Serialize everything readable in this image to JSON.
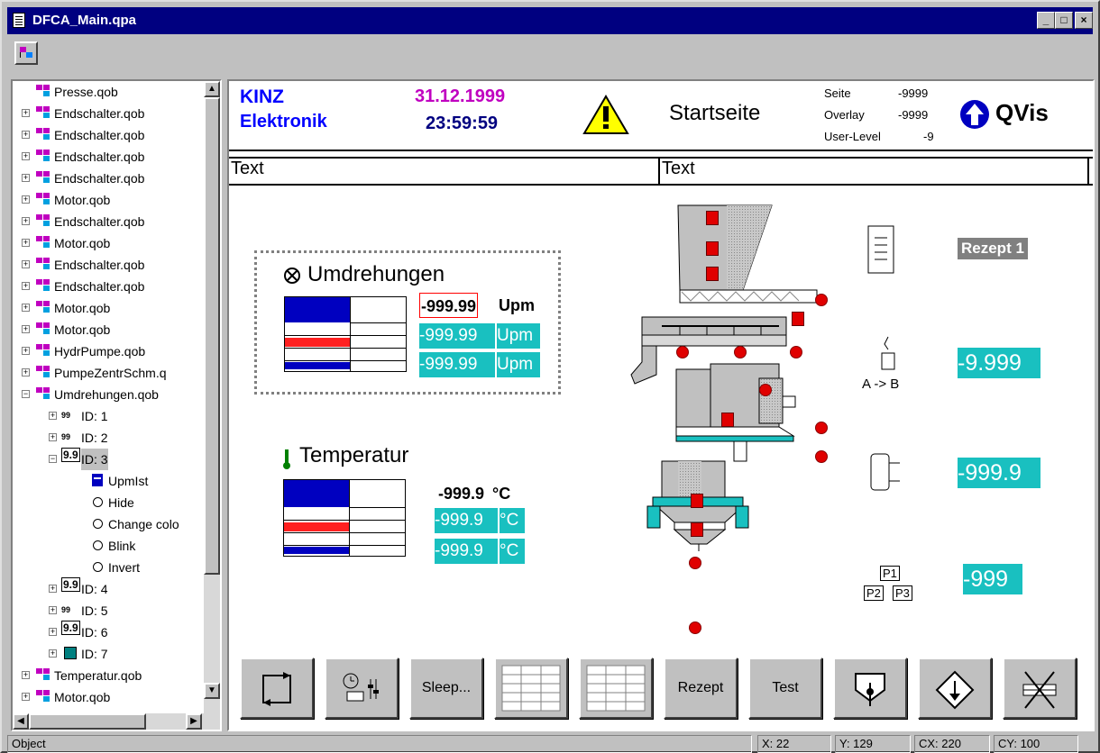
{
  "window": {
    "title": "DFCA_Main.qpa",
    "btn_min": "_",
    "btn_max": "□",
    "btn_close": "×"
  },
  "tree": {
    "items": [
      {
        "label": "Presse.qob",
        "icon": "component-icon"
      },
      {
        "label": "Endschalter.qob",
        "icon": "component-icon"
      },
      {
        "label": "Endschalter.qob",
        "icon": "component-icon"
      },
      {
        "label": "Endschalter.qob",
        "icon": "component-icon"
      },
      {
        "label": "Endschalter.qob",
        "icon": "component-icon"
      },
      {
        "label": "Motor.qob",
        "icon": "component-icon"
      },
      {
        "label": "Endschalter.qob",
        "icon": "component-icon"
      },
      {
        "label": "Motor.qob",
        "icon": "component-icon"
      },
      {
        "label": "Endschalter.qob",
        "icon": "component-icon"
      },
      {
        "label": "Endschalter.qob",
        "icon": "component-icon"
      },
      {
        "label": "Motor.qob",
        "icon": "component-icon"
      },
      {
        "label": "Motor.qob",
        "icon": "component-icon"
      },
      {
        "label": "HydrPumpe.qob",
        "icon": "component-icon"
      },
      {
        "label": "PumpeZentrSchm.q",
        "icon": "component-icon"
      },
      {
        "label": "Umdrehungen.qob",
        "icon": "component-icon"
      },
      {
        "label": "ID: 1",
        "icon": "bar-value-icon",
        "prefix": "99"
      },
      {
        "label": "ID: 2",
        "icon": "bar-value-icon",
        "prefix": "99"
      },
      {
        "label": "ID: 3",
        "icon": "value-icon",
        "prefix": "9.9"
      },
      {
        "label": "UpmIst",
        "icon": "list-icon"
      },
      {
        "label": "Hide",
        "icon": "radio-icon"
      },
      {
        "label": "Change colo",
        "icon": "radio-icon"
      },
      {
        "label": "Blink",
        "icon": "radio-icon"
      },
      {
        "label": "Invert",
        "icon": "radio-icon"
      },
      {
        "label": "ID: 4",
        "icon": "value-icon",
        "prefix": "9.9"
      },
      {
        "label": "ID: 5",
        "icon": "bar-value-icon",
        "prefix": "99"
      },
      {
        "label": "ID: 6",
        "icon": "value-icon",
        "prefix": "9.9"
      },
      {
        "label": "ID: 7",
        "icon": "picture-icon"
      },
      {
        "label": "Temperatur.qob",
        "icon": "component-icon"
      },
      {
        "label": "Motor.qob",
        "icon": "component-icon"
      }
    ]
  },
  "header": {
    "brand_line1": "KINZ",
    "brand_line2": "Elektronik",
    "date": "31.12.1999",
    "time": "23:59:59",
    "page_title": "Startseite",
    "seite_label": "Seite",
    "seite_value": "-9999",
    "overlay_label": "Overlay",
    "overlay_value": "-9999",
    "userlevel_label": "User-Level",
    "userlevel_value": "-9",
    "qvis": "QVis"
  },
  "text_row": {
    "left": "Text",
    "right": "Text"
  },
  "umdrehungen": {
    "title": "Umdrehungen",
    "value1": "-999.99",
    "unit1": "Upm",
    "value2": "-999.99",
    "unit2": "Upm",
    "value3": "-999.99",
    "unit3": "Upm"
  },
  "temperatur": {
    "title": "Temperatur",
    "value1": "-999.9",
    "unit1": "°C",
    "value2": "-999.9",
    "unit2": "°C",
    "value3": "-999.9",
    "unit3": "°C"
  },
  "side_panel": {
    "rezept": "Rezept 1",
    "ab_label": "A -> B",
    "value_ab": "-9.999",
    "value_mid": "-999.9",
    "value_p": "-999",
    "p1": "P1",
    "p2": "P2",
    "p3": "P3"
  },
  "buttons": {
    "sleep": "Sleep...",
    "rezept": "Rezept",
    "test": "Test"
  },
  "statusbar": {
    "object": "Object",
    "x": "X: 22",
    "y": "Y: 129",
    "cx": "CX: 220",
    "cy": "CY: 100"
  },
  "colors": {
    "titlebar": "#000080",
    "teal": "#19c0c0",
    "bar_blue": "#0000c0",
    "bar_red": "#ff2020",
    "brand": "#0000ff",
    "date": "#c000c0"
  }
}
